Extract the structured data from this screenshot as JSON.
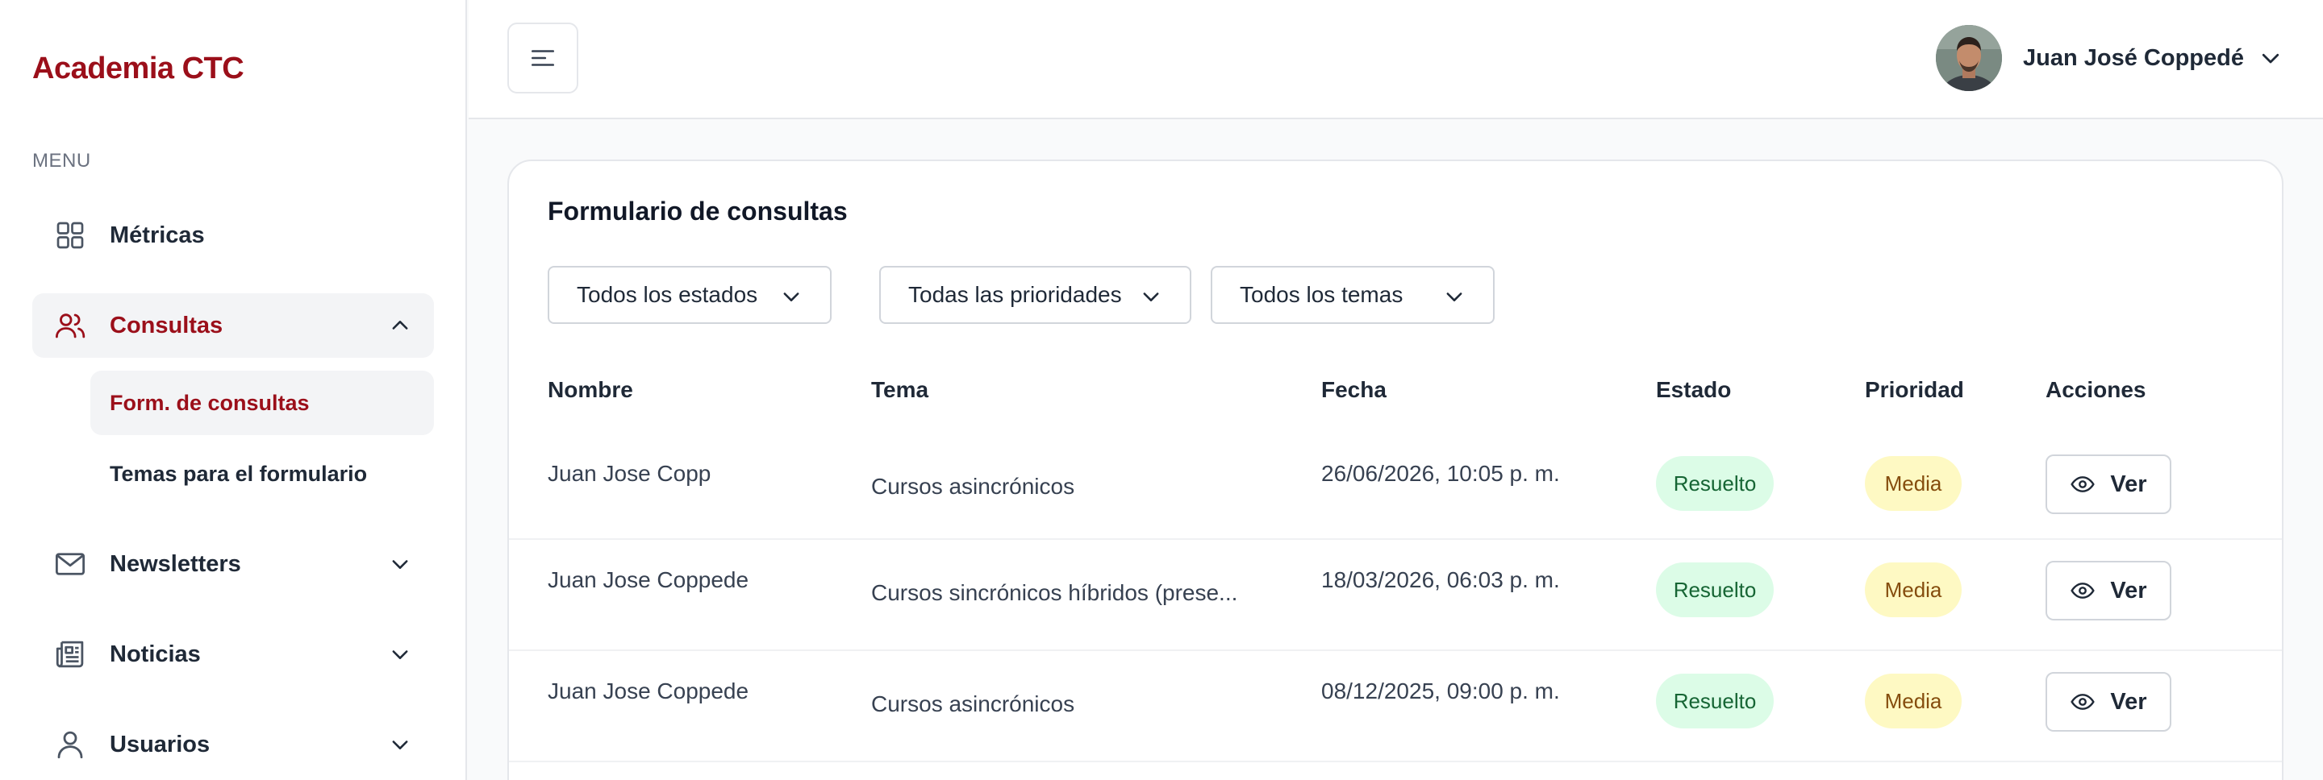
{
  "app": {
    "brand": "Academia CTC"
  },
  "colors": {
    "brand": "#9b0f1a",
    "estado_bg": "#dcfce7",
    "prio_bg": "#fef9c3"
  },
  "sidebar": {
    "menu_label": "MENU",
    "items": [
      {
        "label": "Métricas",
        "icon": "grid-icon"
      },
      {
        "label": "Consultas",
        "icon": "users-icon",
        "expanded": true
      },
      {
        "label": "Newsletters",
        "icon": "mail-icon"
      },
      {
        "label": "Noticias",
        "icon": "newspaper-icon"
      },
      {
        "label": "Usuarios",
        "icon": "user-icon"
      }
    ],
    "subitems": [
      {
        "label": "Form. de consultas"
      },
      {
        "label": "Temas para el formulario"
      }
    ]
  },
  "header": {
    "user_name": "Juan José Coppedé"
  },
  "main": {
    "title": "Formulario de consultas",
    "filters": [
      {
        "value": "Todos los estados"
      },
      {
        "value": "Todas las prioridades"
      },
      {
        "value": "Todos los temas"
      }
    ],
    "table": {
      "columns": [
        "Nombre",
        "Tema",
        "Fecha",
        "Estado",
        "Prioridad",
        "Acciones"
      ],
      "rows": [
        {
          "nombre": "Juan Jose Copp",
          "tema": "Cursos asincrónicos",
          "fecha": "26/06/2026, 10:05 p. m.",
          "estado": "Resuelto",
          "prioridad": "Media",
          "accion": "Ver"
        },
        {
          "nombre": "Juan Jose Coppede",
          "tema": "Cursos sincrónicos híbridos (prese...",
          "fecha": "18/03/2026, 06:03 p. m.",
          "estado": "Resuelto",
          "prioridad": "Media",
          "accion": "Ver"
        },
        {
          "nombre": "Juan Jose Coppede",
          "tema": "Cursos asincrónicos",
          "fecha": "08/12/2025, 09:00 p. m.",
          "estado": "Resuelto",
          "prioridad": "Media",
          "accion": "Ver"
        }
      ]
    }
  }
}
